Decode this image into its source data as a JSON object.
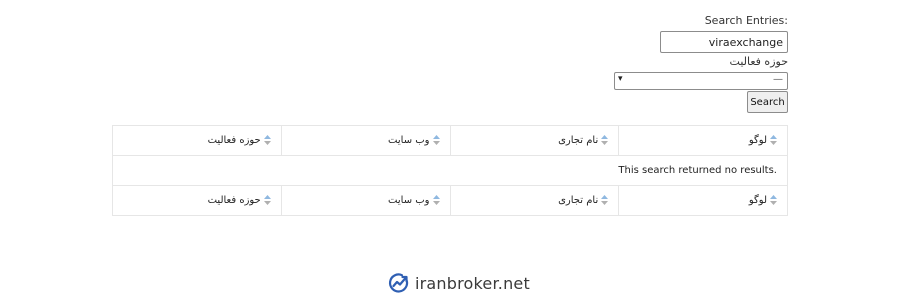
{
  "search": {
    "entries_label": "Search Entries:",
    "entries_value": "viraexchange",
    "field_label": "حوزه فعالیت",
    "field_select_value": "—",
    "button_label": "Search"
  },
  "table": {
    "headers": [
      "لوگو",
      "نام تجاری",
      "وب سایت",
      "حوزه فعالیت"
    ],
    "footers": [
      "لوگو",
      "نام تجاری",
      "وب سایت",
      "حوزه فعالیت"
    ],
    "no_results": "This search returned no results."
  },
  "footer": {
    "brand": "iranbroker.net"
  },
  "colors": {
    "sort_up": "#8fb8e0",
    "sort_down": "#b0b0b0",
    "brand_icon": "#2f5fb3",
    "border": "#e6e6e6"
  },
  "icons": {
    "sort": "sort-arrows-icon",
    "brand": "trend-chart-logo-icon"
  }
}
